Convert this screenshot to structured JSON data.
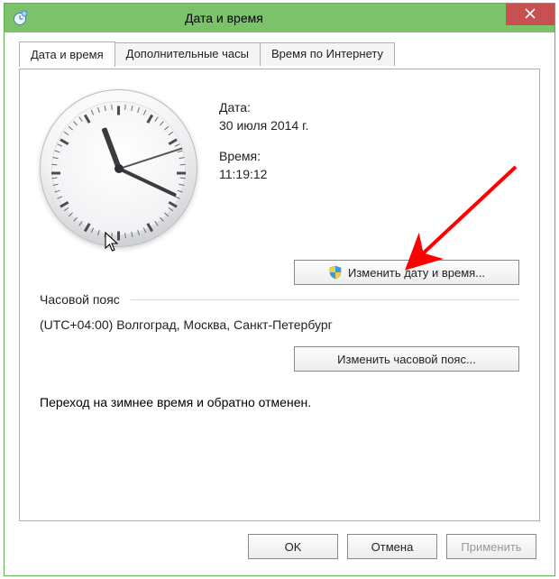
{
  "window": {
    "title": "Дата и время"
  },
  "tabs": {
    "datetime": "Дата и время",
    "additional_clocks": "Дополнительные часы",
    "internet_time": "Время по Интернету"
  },
  "main": {
    "date_label": "Дата:",
    "date_value": "30 июля 2014 г.",
    "time_label": "Время:",
    "time_value": "11:19:12",
    "change_datetime_button": "Изменить дату и время..."
  },
  "timezone": {
    "section_title": "Часовой пояс",
    "value": "(UTC+04:00) Волгоград, Москва, Санкт-Петербург",
    "change_tz_button": "Изменить часовой пояс..."
  },
  "dst_note": "Переход на зимнее время и обратно отменен.",
  "footer": {
    "ok": "OK",
    "cancel": "Отмена",
    "apply": "Применить"
  },
  "clock": {
    "hour": 11,
    "minute": 19,
    "second": 12
  }
}
